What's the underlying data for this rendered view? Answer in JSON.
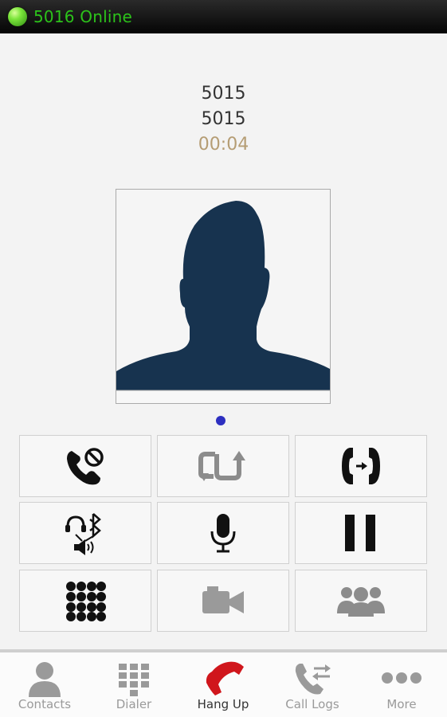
{
  "status": {
    "text": "5016 Online",
    "indicator_color": "#57d41e"
  },
  "call": {
    "name": "5015",
    "number": "5015",
    "duration": "00:04"
  },
  "controls": [
    {
      "icon": "call-reject-icon",
      "enabled": true
    },
    {
      "icon": "call-transfer-icon",
      "enabled": false
    },
    {
      "icon": "call-forward-icon",
      "enabled": true
    },
    {
      "icon": "audio-route-bluetooth-icon",
      "enabled": true
    },
    {
      "icon": "microphone-icon",
      "enabled": true
    },
    {
      "icon": "pause-icon",
      "enabled": true
    },
    {
      "icon": "keypad-icon",
      "enabled": true
    },
    {
      "icon": "video-camera-icon",
      "enabled": false
    },
    {
      "icon": "conference-icon",
      "enabled": false
    }
  ],
  "nav": {
    "contacts": "Contacts",
    "dialer": "Dialer",
    "hangup": "Hang Up",
    "call_logs": "Call Logs",
    "more": "More"
  },
  "colors": {
    "accent_red": "#d0161c",
    "avatar_silhouette": "#17334f",
    "timer": "#b59d74"
  }
}
